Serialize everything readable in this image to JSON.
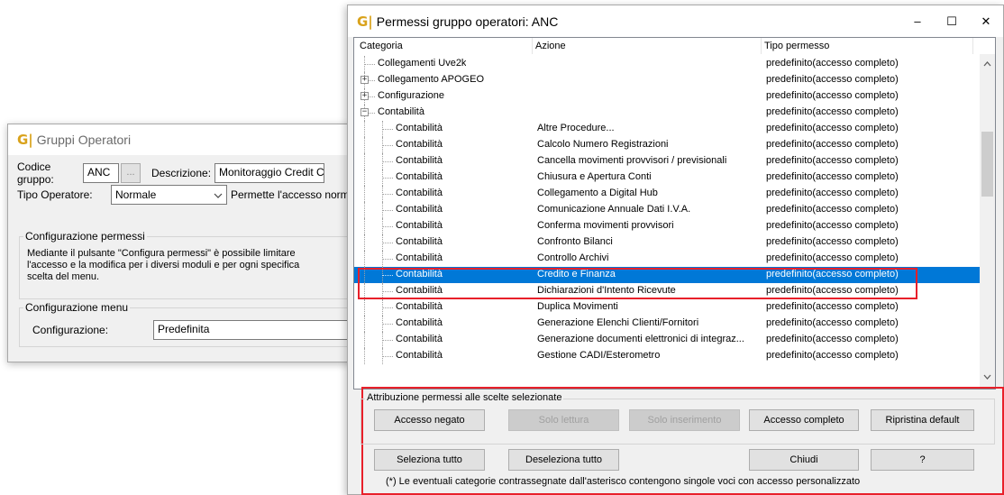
{
  "gruppi_window": {
    "logo": "G|",
    "title": "Gruppi Operatori",
    "codice_label": "Codice gruppo:",
    "codice_value": "ANC",
    "dots_label": "...",
    "descrizione_label": "Descrizione:",
    "descrizione_value": "Monitoraggio Credit C",
    "tipo_label": "Tipo Operatore:",
    "tipo_value": "Normale",
    "tipo_note": "Permette l'accesso normale",
    "perm_group_label": "Configurazione permessi",
    "perm_text_1": "Mediante il pulsante \"Configura permessi\" è possibile limitare",
    "perm_text_2": "l'accesso e la modifica per i diversi moduli e per ogni specifica",
    "perm_text_3": "scelta del menu.",
    "menu_group_label": "Configurazione menu",
    "config_label": "Configurazione:",
    "config_value": "Predefinita"
  },
  "permessi_window": {
    "logo": "G|",
    "title": "Permessi gruppo operatori: ANC",
    "controls": {
      "minimize": "–",
      "maximize": "☐",
      "close": "✕"
    },
    "columns": [
      "Categoria",
      "Azione",
      "Tipo permesso"
    ],
    "rows": [
      {
        "level": 0,
        "expander": "",
        "categoria": "Collegamenti Uve2k",
        "azione": "",
        "tipo": "predefinito(accesso completo)"
      },
      {
        "level": 0,
        "expander": "+",
        "categoria": "Collegamento APOGEO",
        "azione": "",
        "tipo": "predefinito(accesso completo)"
      },
      {
        "level": 0,
        "expander": "+",
        "categoria": "Configurazione",
        "azione": "",
        "tipo": "predefinito(accesso completo)"
      },
      {
        "level": 0,
        "expander": "-",
        "categoria": "Contabilità",
        "azione": "",
        "tipo": "predefinito(accesso completo)"
      },
      {
        "level": 1,
        "expander": "",
        "categoria": "Contabilità",
        "azione": "Altre Procedure...",
        "tipo": "predefinito(accesso completo)"
      },
      {
        "level": 1,
        "expander": "",
        "categoria": "Contabilità",
        "azione": "Calcolo Numero Registrazioni",
        "tipo": "predefinito(accesso completo)"
      },
      {
        "level": 1,
        "expander": "",
        "categoria": "Contabilità",
        "azione": "Cancella movimenti provvisori / previsionali",
        "tipo": "predefinito(accesso completo)"
      },
      {
        "level": 1,
        "expander": "",
        "categoria": "Contabilità",
        "azione": "Chiusura e Apertura Conti",
        "tipo": "predefinito(accesso completo)"
      },
      {
        "level": 1,
        "expander": "",
        "categoria": "Contabilità",
        "azione": "Collegamento a Digital Hub",
        "tipo": "predefinito(accesso completo)"
      },
      {
        "level": 1,
        "expander": "",
        "categoria": "Contabilità",
        "azione": "Comunicazione Annuale Dati I.V.A.",
        "tipo": "predefinito(accesso completo)"
      },
      {
        "level": 1,
        "expander": "",
        "categoria": "Contabilità",
        "azione": "Conferma movimenti provvisori",
        "tipo": "predefinito(accesso completo)"
      },
      {
        "level": 1,
        "expander": "",
        "categoria": "Contabilità",
        "azione": "Confronto Bilanci",
        "tipo": "predefinito(accesso completo)"
      },
      {
        "level": 1,
        "expander": "",
        "categoria": "Contabilità",
        "azione": "Controllo Archivi",
        "tipo": "predefinito(accesso completo)"
      },
      {
        "level": 1,
        "expander": "",
        "categoria": "Contabilità",
        "azione": "Credito e Finanza",
        "tipo": "predefinito(accesso completo)",
        "selected": true
      },
      {
        "level": 1,
        "expander": "",
        "categoria": "Contabilità",
        "azione": "Dichiarazioni d'Intento Ricevute",
        "tipo": "predefinito(accesso completo)"
      },
      {
        "level": 1,
        "expander": "",
        "categoria": "Contabilità",
        "azione": "Duplica Movimenti",
        "tipo": "predefinito(accesso completo)"
      },
      {
        "level": 1,
        "expander": "",
        "categoria": "Contabilità",
        "azione": "Generazione Elenchi Clienti/Fornitori",
        "tipo": "predefinito(accesso completo)"
      },
      {
        "level": 1,
        "expander": "",
        "categoria": "Contabilità",
        "azione": "Generazione documenti elettronici di integraz...",
        "tipo": "predefinito(accesso completo)"
      },
      {
        "level": 1,
        "expander": "",
        "categoria": "Contabilità",
        "azione": "Gestione CADI/Esterometro",
        "tipo": "predefinito(accesso completo)"
      }
    ],
    "attrib_group_label": "Attribuzione permessi alle scelte selezionate",
    "buttons": {
      "accesso_negato": "Accesso negato",
      "solo_lettura": "Solo lettura",
      "solo_inserimento": "Solo inserimento",
      "accesso_completo": "Accesso completo",
      "ripristina_default": "Ripristina default",
      "seleziona_tutto": "Seleziona tutto",
      "deseleziona_tutto": "Deseleziona tutto",
      "chiudi": "Chiudi",
      "help": "?"
    },
    "footnote": "(*) Le eventuali categorie contrassegnate dall'asterisco contengono singole voci con accesso personalizzato",
    "selected_color": "#0078d7",
    "highlight_color": "#e8202a"
  }
}
